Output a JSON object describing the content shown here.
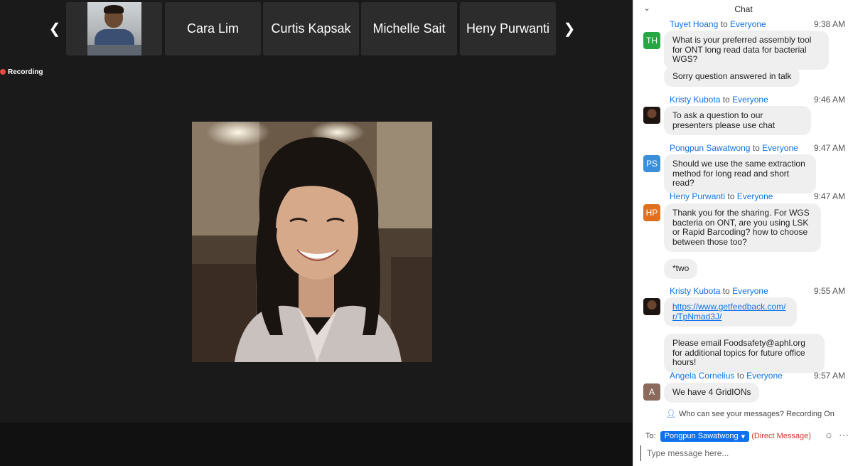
{
  "gallery": {
    "participants": [
      {
        "name": "Cara Lim"
      },
      {
        "name": "Curtis Kapsak"
      },
      {
        "name": "Michelle Sait"
      },
      {
        "name": "Heny Purwanti"
      }
    ],
    "prev_icon": "chevron-left-icon",
    "next_icon": "chevron-right-icon"
  },
  "recording": {
    "label": "Recording",
    "color": "#e8473f"
  },
  "chat": {
    "title": "Chat",
    "accent_color": "#0e72ed",
    "messages": [
      {
        "sender": "Tuyet Hoang",
        "to": "to",
        "target": "Everyone",
        "time": "9:38 AM",
        "avatar_initials": "TH",
        "avatar_color": "#27a644",
        "texts": [
          "What is your preferred assembly tool for ONT long read data for bacterial WGS?",
          "Sorry question answered in talk"
        ]
      },
      {
        "sender": "Kristy Kubota",
        "to": "to",
        "target": "Everyone",
        "time": "9:46 AM",
        "avatar_initials": "",
        "texts": [
          "To ask a question to our presenters please use chat"
        ]
      },
      {
        "sender": "Pongpun Sawatwong",
        "to": "to",
        "target": "Everyone",
        "time": "9:47 AM",
        "avatar_initials": "PS",
        "avatar_color": "#3b8fd9",
        "texts": [
          "Should we use the same extraction method for long read and short read?"
        ]
      },
      {
        "sender": "Heny Purwanti",
        "to": "to",
        "target": "Everyone",
        "time": "9:47 AM",
        "avatar_initials": "HP",
        "avatar_color": "#e0701e",
        "texts": [
          "Thank you for the sharing. For WGS bacteria on ONT, are you using LSK or Rapid Barcoding? how to choose between those too?",
          "*two"
        ]
      },
      {
        "sender": "Kristy Kubota",
        "to": "to",
        "target": "Everyone",
        "time": "9:55 AM",
        "avatar_initials": "",
        "texts": [
          "https://www.getfeedback.com/r/TpNmad3J/",
          "Please email Foodsafety@aphl.org for additional topics for future office hours!"
        ]
      },
      {
        "sender": "Angela Cornelius",
        "to": "to",
        "target": "Everyone",
        "time": "9:57 AM",
        "avatar_initials": "A",
        "avatar_color": "#8a6a5c",
        "texts": [
          "We have 4 GridIONs"
        ]
      }
    ],
    "privacy_text": "Who can see your messages? Recording On",
    "to_label": "To:",
    "recipient": "Pongpun Sawatwong",
    "direct_message_label": "(Direct Message)",
    "direct_message_color": "#d8362c",
    "input_placeholder": "Type message here..."
  }
}
